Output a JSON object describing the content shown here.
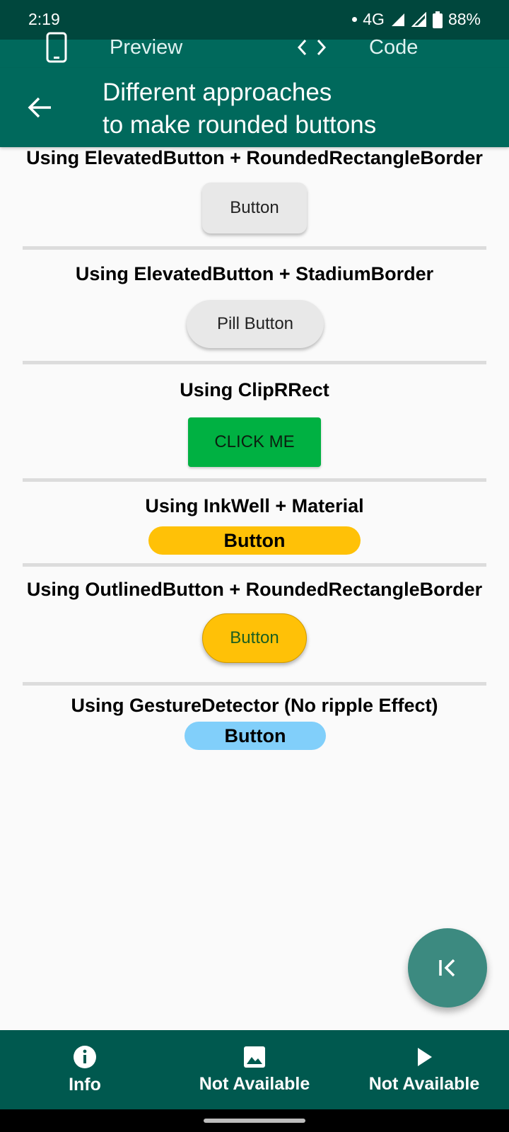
{
  "status": {
    "time": "2:19",
    "network": "4G",
    "battery": "88%"
  },
  "tabs": {
    "preview_label": "Preview",
    "code_label": "Code"
  },
  "appbar": {
    "title_line1": "Different approaches",
    "title_line2": "to make rounded buttons"
  },
  "sections": [
    {
      "title": "Using ElevatedButton + RoundedRectangleBorder",
      "button": "Button"
    },
    {
      "title": "Using ElevatedButton + StadiumBorder",
      "button": "Pill Button"
    },
    {
      "title": "Using ClipRRect",
      "button": "CLICK ME"
    },
    {
      "title": "Using InkWell + Material",
      "button": "Button"
    },
    {
      "title": "Using OutlinedButton + RoundedRectangleBorder",
      "button": "Button"
    },
    {
      "title": "Using GestureDetector (No ripple Effect)",
      "button": "Button"
    }
  ],
  "fab_icon": "first-page-icon",
  "bottom_nav": [
    {
      "icon": "info-icon",
      "label": "Info"
    },
    {
      "icon": "image-icon",
      "label": "Not Available"
    },
    {
      "icon": "play-icon",
      "label": "Not Available"
    }
  ],
  "colors": {
    "primary": "#00695c",
    "status_bar": "#00473d",
    "bottom_nav": "#00594f",
    "green_button": "#00b142",
    "amber_button": "#ffc107",
    "blue_button": "#81cffa"
  }
}
